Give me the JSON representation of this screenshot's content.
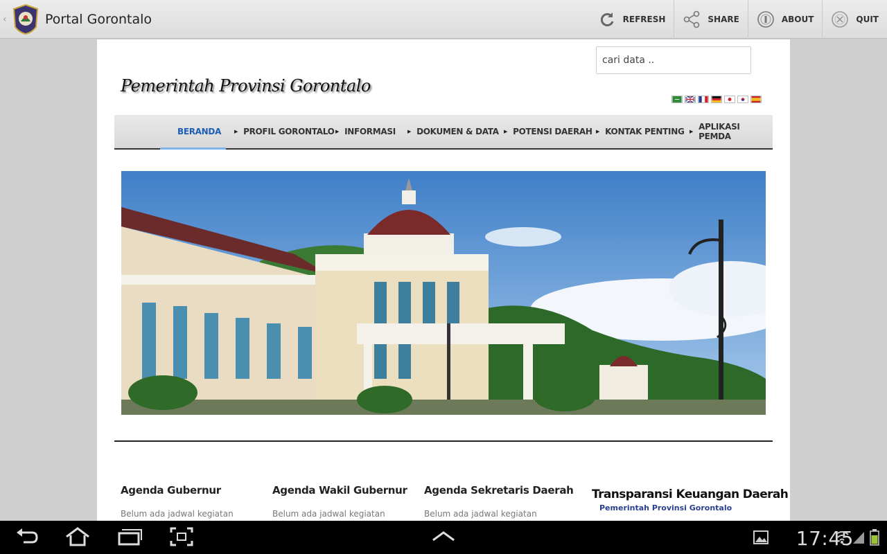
{
  "app": {
    "title": "Portal Gorontalo",
    "actions": [
      {
        "label": "REFRESH",
        "icon": "refresh-icon"
      },
      {
        "label": "SHARE",
        "icon": "share-icon"
      },
      {
        "label": "ABOUT",
        "icon": "info-icon"
      },
      {
        "label": "QUIT",
        "icon": "quit-icon"
      }
    ]
  },
  "header": {
    "logo_text": "Pemerintah Provinsi Gorontalo",
    "search_placeholder": "cari data ..",
    "flags": [
      "arabic-flag",
      "uk-flag",
      "france-flag",
      "germany-flag",
      "japan-flag",
      "korea-flag",
      "spain-flag"
    ]
  },
  "nav": {
    "items": [
      {
        "label": "BERANDA",
        "active": true
      },
      {
        "label": "PROFIL GORONTALO",
        "active": false
      },
      {
        "label": "INFORMASI",
        "active": false
      },
      {
        "label": "DOKUMEN & DATA",
        "active": false
      },
      {
        "label": "POTENSI DAERAH",
        "active": false
      },
      {
        "label": "KONTAK PENTING",
        "active": false
      },
      {
        "label": "APLIKASI PEMDA",
        "active": false
      }
    ]
  },
  "agenda": [
    {
      "title": "Agenda Gubernur",
      "note": "Belum ada jadwal kegiatan"
    },
    {
      "title": "Agenda Wakil Gubernur",
      "note": "Belum ada jadwal kegiatan"
    },
    {
      "title": "Agenda Sekretaris Daerah",
      "note": "Belum ada jadwal kegiatan"
    }
  ],
  "transparansi": {
    "title": "Transparansi Keuangan Daerah",
    "subtitle": "Pemerintah Provinsi Gorontalo"
  },
  "system": {
    "clock": "17:45"
  },
  "colors": {
    "nav_active": "#1f5fb3",
    "sky": "#3f7fc8"
  }
}
